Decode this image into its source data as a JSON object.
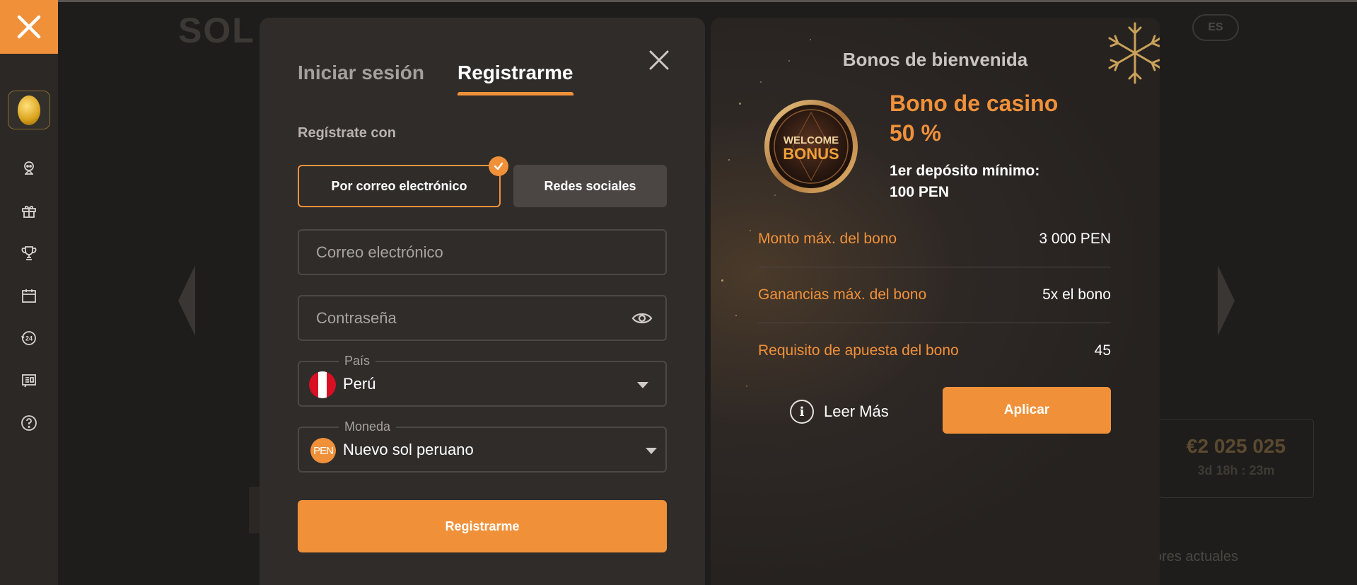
{
  "sidebar": {
    "items": [
      {
        "icon": "robot-icon"
      },
      {
        "icon": "gift-icon"
      },
      {
        "icon": "trophy-icon"
      },
      {
        "icon": "calendar-icon"
      },
      {
        "icon": "support-24-icon"
      },
      {
        "icon": "news-icon"
      },
      {
        "icon": "help-icon"
      }
    ]
  },
  "background": {
    "logo": "SOL",
    "language": "ES",
    "jackpot_amount": "€2 025 025",
    "jackpot_timer": "3d 18h : 23m",
    "footer_text": "ores actuales"
  },
  "auth": {
    "tab_login": "Iniciar sesión",
    "tab_register": "Registrarme",
    "register_with": "Regístrate con",
    "method_email": "Por correo electrónico",
    "method_social": "Redes sociales",
    "email_placeholder": "Correo electrónico",
    "password_placeholder": "Contraseña",
    "country_label": "País",
    "country_value": "Perú",
    "currency_label": "Moneda",
    "currency_code": "PEN",
    "currency_value": "Nuevo sol peruano",
    "submit": "Registrarme"
  },
  "bonus": {
    "panel_title": "Bonos de bienvenida",
    "badge_line1": "WELCOME",
    "badge_line2": "BONUS",
    "name_line1": "Bono de casino",
    "name_line2": "50 %",
    "min_deposit_line1": "1er depósito mínimo:",
    "min_deposit_line2": "100 PEN",
    "rows": [
      {
        "label": "Monto máx. del bono",
        "value": "3 000 PEN"
      },
      {
        "label": "Ganancias máx. del bono",
        "value": "5x el bono"
      },
      {
        "label": "Requisito de apuesta del bono",
        "value": "45"
      }
    ],
    "read_more": "Leer Más",
    "apply": "Aplicar"
  },
  "colors": {
    "accent": "#f0913a",
    "panel": "#2f2c2a",
    "sidebar": "#2b2826"
  }
}
